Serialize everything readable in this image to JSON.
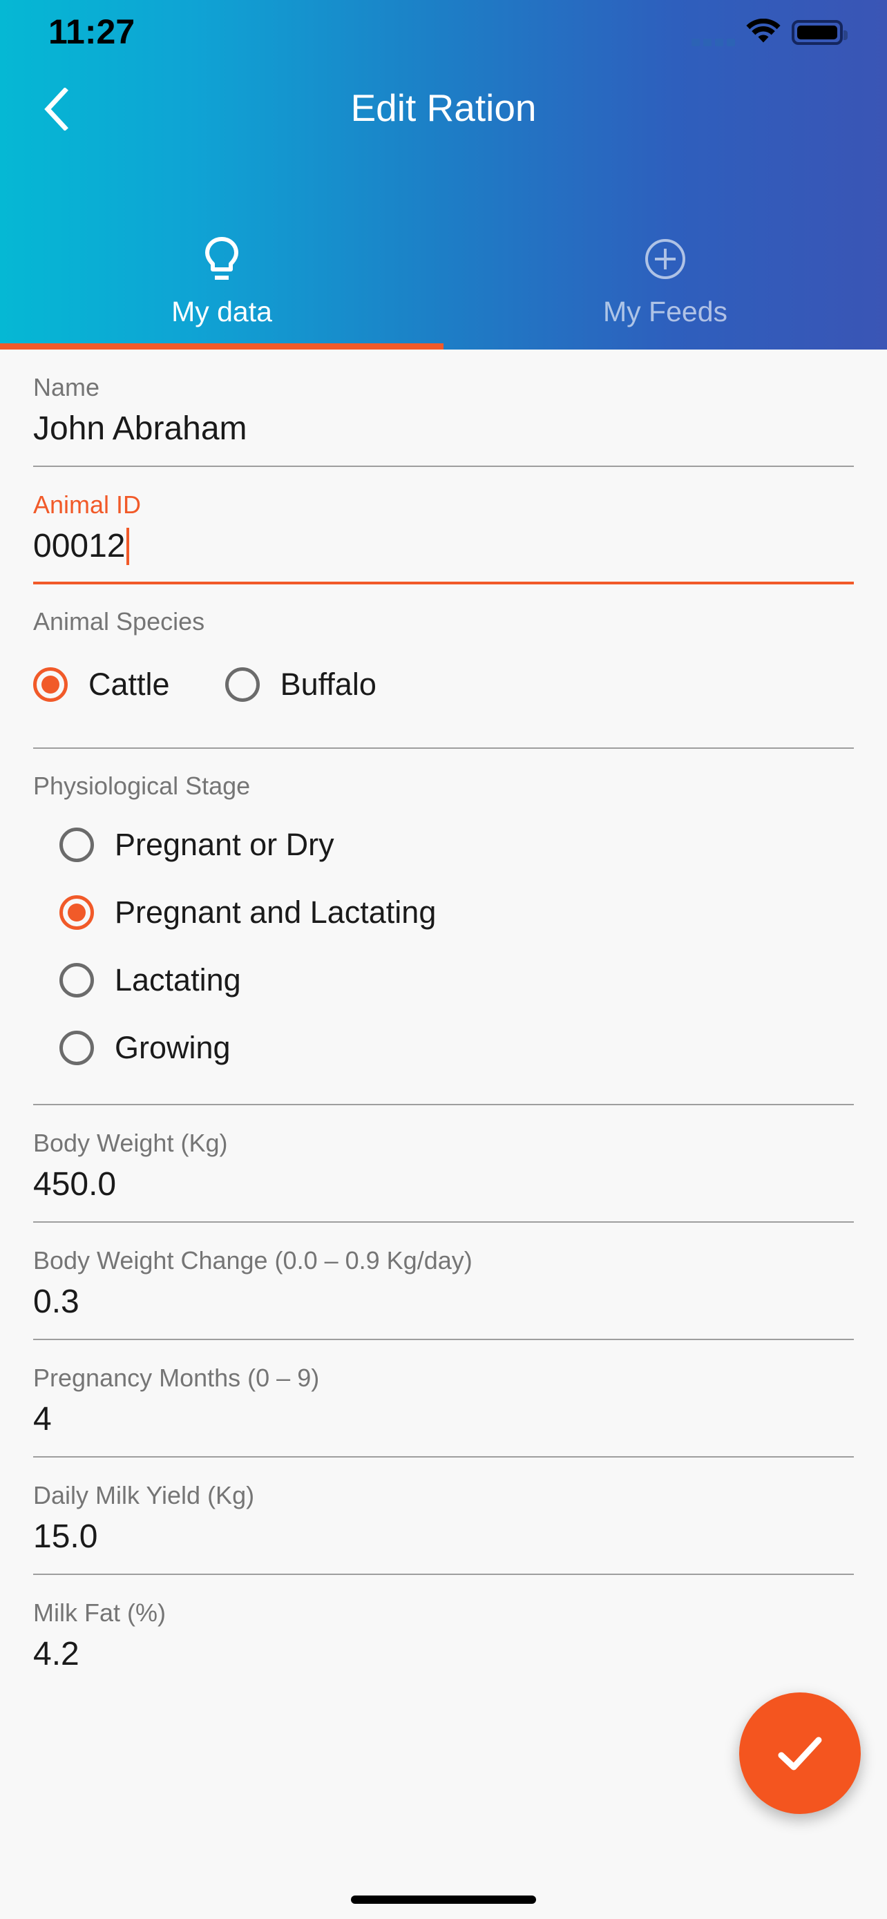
{
  "status_bar": {
    "time": "11:27",
    "icons": [
      "signal-dots-icon",
      "wifi-icon",
      "battery-icon"
    ]
  },
  "header": {
    "title": "Edit Ration",
    "back_icon": "back-chevron-icon",
    "gradient_start": "#05b8d4",
    "gradient_end": "#3a55b5",
    "accent_color": "#f15a29"
  },
  "tabs": {
    "active_index": 0,
    "items": [
      {
        "label": "My data",
        "icon": "lightbulb-icon",
        "active": true
      },
      {
        "label": "My Feeds",
        "icon": "plus-circle-icon",
        "active": false
      }
    ]
  },
  "form": {
    "fields": [
      {
        "label": "Name",
        "value": "John Abraham",
        "focused": false
      },
      {
        "label": "Animal ID",
        "value": "00012",
        "focused": true
      }
    ],
    "species": {
      "label": "Animal Species",
      "selected": "Cattle",
      "options": [
        "Cattle",
        "Buffalo"
      ]
    },
    "physiological_stage": {
      "label": "Physiological Stage",
      "selected": "Pregnant and Lactating",
      "options": [
        "Pregnant or Dry",
        "Pregnant and Lactating",
        "Lactating",
        "Growing"
      ]
    },
    "numeric_fields": [
      {
        "label": "Body Weight (Kg)",
        "value": "450.0"
      },
      {
        "label": "Body Weight Change (0.0 – 0.9 Kg/day)",
        "value": "0.3"
      },
      {
        "label": "Pregnancy Months (0 – 9)",
        "value": "4"
      },
      {
        "label": "Daily Milk Yield (Kg)",
        "value": "15.0"
      },
      {
        "label": "Milk Fat (%)",
        "value": "4.2"
      }
    ]
  },
  "fab": {
    "icon": "check-icon",
    "color": "#f4551f"
  }
}
